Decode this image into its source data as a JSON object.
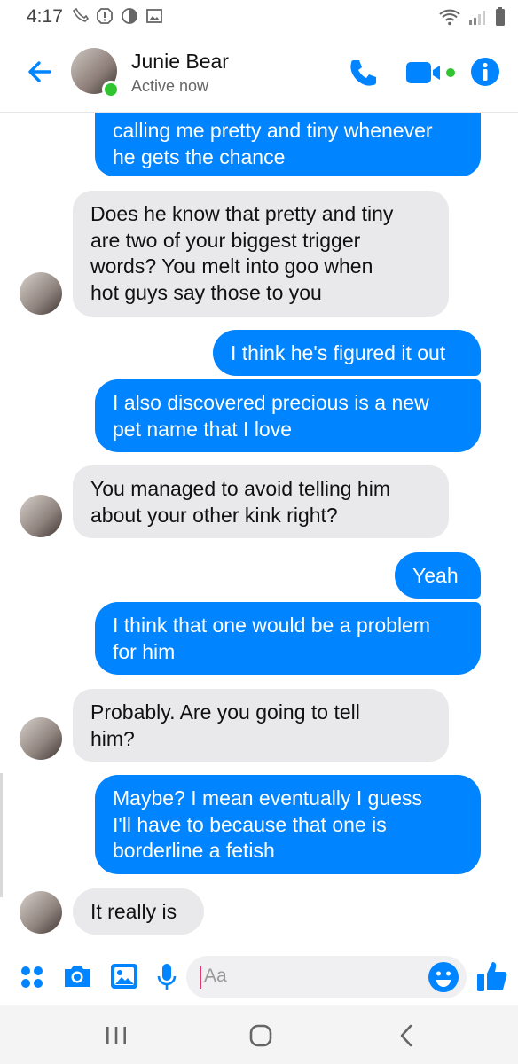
{
  "status_bar": {
    "time": "4:17"
  },
  "header": {
    "contact_name": "Junie Bear",
    "contact_status": "Active now"
  },
  "messages": [
    {
      "from": "me",
      "text": "calling me pretty and tiny whenever\nhe gets the chance"
    },
    {
      "from": "them",
      "text": "Does he know that pretty and tiny\nare two of your biggest trigger\nwords? You melt into goo when\nhot guys say those to you"
    },
    {
      "from": "me",
      "text": "I think he's figured it out"
    },
    {
      "from": "me",
      "text": "I also discovered precious is a new\npet name that I love"
    },
    {
      "from": "them",
      "text": "You managed to avoid telling him\nabout your other kink right?"
    },
    {
      "from": "me",
      "text": "Yeah"
    },
    {
      "from": "me",
      "text": "I think that one would be a problem\nfor him"
    },
    {
      "from": "them",
      "text": "Probably. Are you going to tell\nhim?"
    },
    {
      "from": "me",
      "text": "Maybe? I mean eventually I guess\nI'll have to because that one is\nborderline a fetish"
    },
    {
      "from": "them",
      "text": "It really is"
    }
  ],
  "composer": {
    "placeholder": "Aa"
  },
  "colors": {
    "accent": "#0084ff",
    "incoming_bubble": "#e9e9eb",
    "online": "#31c431"
  },
  "icons": [
    "back-arrow-icon",
    "phone-icon",
    "video-camera-icon",
    "info-icon",
    "apps-icon",
    "camera-icon",
    "gallery-icon",
    "microphone-icon",
    "emoji-icon",
    "thumbs-up-icon",
    "recents-icon",
    "home-icon",
    "nav-back-icon"
  ]
}
